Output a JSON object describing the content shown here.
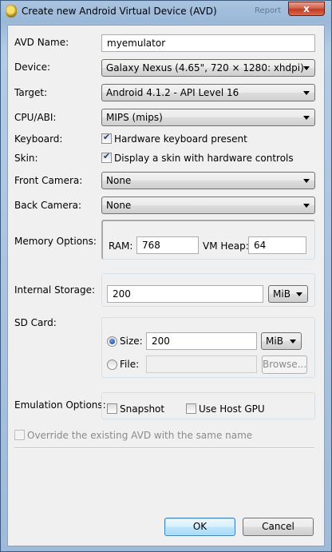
{
  "window": {
    "title": "Create new Android Virtual Device (AVD)",
    "close_label": "x",
    "background_tabs": [
      "Report"
    ]
  },
  "form": {
    "avd_name": {
      "label": "AVD Name:",
      "value": "myemulator"
    },
    "device": {
      "label": "Device:",
      "value": "Galaxy Nexus (4.65\", 720 × 1280: xhdpi)"
    },
    "target": {
      "label": "Target:",
      "value": "Android 4.1.2 - API Level 16"
    },
    "cpu_abi": {
      "label": "CPU/ABI:",
      "value": "MIPS (mips)"
    },
    "keyboard": {
      "label": "Keyboard:",
      "checkbox_label": "Hardware keyboard present",
      "checked": true
    },
    "skin": {
      "label": "Skin:",
      "checkbox_label": "Display a skin with hardware controls",
      "checked": true
    },
    "front_camera": {
      "label": "Front Camera:",
      "value": "None"
    },
    "back_camera": {
      "label": "Back Camera:",
      "value": "None"
    },
    "memory": {
      "label": "Memory Options:",
      "ram_label": "RAM:",
      "ram_value": "768",
      "vmheap_label": "VM Heap:",
      "vmheap_value": "64"
    },
    "internal_storage": {
      "label": "Internal Storage:",
      "value": "200",
      "unit": "MiB"
    },
    "sd_card": {
      "label": "SD Card:",
      "size_label": "Size:",
      "size_value": "200",
      "size_unit": "MiB",
      "size_selected": true,
      "file_label": "File:",
      "file_value": "",
      "browse_label": "Browse..."
    },
    "emulation": {
      "label": "Emulation Options:",
      "snapshot_label": "Snapshot",
      "snapshot_checked": false,
      "host_gpu_label": "Use Host GPU",
      "host_gpu_checked": false
    },
    "override": {
      "label": "Override the existing AVD with the same name",
      "checked": false
    }
  },
  "buttons": {
    "ok": "OK",
    "cancel": "Cancel"
  },
  "colors": {
    "title_bar": "#9bb8d8",
    "client_bg": "#f0f0f0",
    "close_button": "#c23b22",
    "default_button": "#3c7fb1"
  }
}
